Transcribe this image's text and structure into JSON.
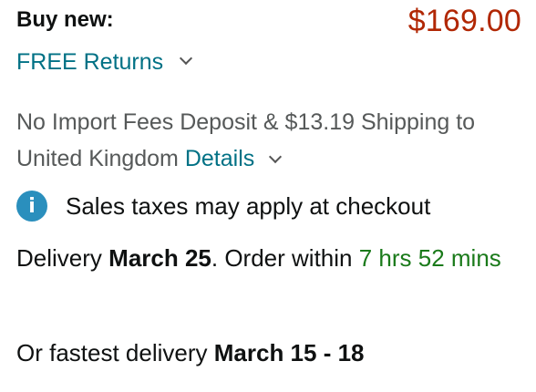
{
  "buy_box": {
    "buy_new_label": "Buy new:",
    "price": "$169.00",
    "returns_link": "FREE Returns",
    "import_fees_text": "No Import Fees Deposit & $13.19 Shipping to United Kingdom",
    "details_link": "Details",
    "tax_note": "Sales taxes may apply at checkout",
    "info_icon_glyph": "i",
    "delivery_prefix": "Delivery",
    "delivery_date": "March 25",
    "order_within_text": ". Order within",
    "countdown": "7 hrs 52 mins",
    "fastest_prefix": "Or fastest delivery",
    "fastest_dates": "March 15 - 18"
  },
  "icons": {
    "returns_chevron": "chevron-down-icon",
    "details_chevron": "chevron-down-icon",
    "info": "info-icon"
  },
  "colors": {
    "price": "#b12704",
    "link": "#007185",
    "muted_text": "#565959",
    "countdown": "#1a7a1a",
    "info_icon": "#2a8fbd"
  }
}
